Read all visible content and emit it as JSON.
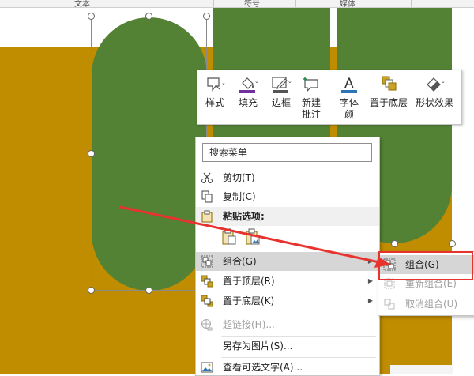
{
  "ruler": {
    "labels": [
      "文本",
      "符号",
      "媒体"
    ]
  },
  "mini_toolbar": {
    "items": [
      {
        "label": "样式",
        "icon": "shape-style-icon"
      },
      {
        "label": "填充",
        "icon": "paint-bucket-icon"
      },
      {
        "label": "边框",
        "icon": "pen-outline-icon"
      },
      {
        "label": "新建\n批注",
        "icon": "new-comment-icon"
      },
      {
        "label": "字体\n颜",
        "icon": "font-color-icon"
      },
      {
        "label": "置于底层",
        "icon": "send-to-back-icon"
      },
      {
        "label": "形状效果",
        "icon": "shape-effects-icon"
      }
    ],
    "colors": {
      "fill_underline": "#7030a0",
      "font_underline": "#2e75b6"
    }
  },
  "context_menu": {
    "search_placeholder": "搜索菜单",
    "cut": "剪切(T)",
    "copy": "复制(C)",
    "paste_options": "粘贴选项:",
    "group": "组合(G)",
    "bring_to_front": "置于顶层(R)",
    "send_to_back": "置于底层(K)",
    "hyperlink": "超链接(H)...",
    "save_as_picture": "另存为图片(S)...",
    "view_alt_text": "查看可选文字(A)..."
  },
  "submenu": {
    "group": "组合(G)",
    "regroup": "重新组合(E)",
    "ungroup": "取消组合(U)"
  },
  "colors": {
    "slide_background": "#c18d00",
    "shape_green": "#548235",
    "highlight": "#d6d6d6",
    "annotation_red": "#e8322e"
  }
}
